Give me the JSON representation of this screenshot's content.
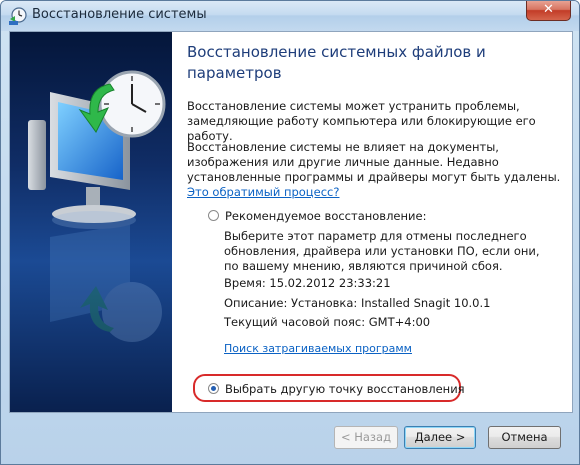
{
  "window": {
    "title": "Восстановление системы",
    "close_label": "✕"
  },
  "main": {
    "heading": "Восстановление системных файлов и параметров",
    "paragraph1": "Восстановление системы может устранить проблемы, замедляющие работу компьютера или блокирующие его работу.",
    "paragraph2_text": "Восстановление системы не влияет на документы, изображения или другие личные данные. Недавно установленные программы и драйверы могут быть удалены.",
    "paragraph2_link": "Это обратимый процесс?",
    "recommended": {
      "label": "Рекомендуемое восстановление:",
      "description": "Выберите этот параметр для отмены последнего обновления, драйвера или установки ПО, если они, по вашему мнению, являются причиной сбоя.",
      "time": "Время: 15.02.2012 23:33:21",
      "description_line": "Описание: Установка: Installed Snagit 10.0.1",
      "timezone": "Текущий часовой пояс: GMT+4:00",
      "affected_link": "Поиск затрагиваемых программ",
      "selected": false
    },
    "other_point": {
      "label": "Выбрать другую точку восстановления",
      "selected": true
    }
  },
  "buttons": {
    "back": "< Назад",
    "next": "Далее >",
    "cancel": "Отмена"
  },
  "icons": {
    "app": "system-restore-icon",
    "illustration": "monitor-with-clock-icon"
  },
  "colors": {
    "heading": "#1e3d7a",
    "link": "#0b62c4",
    "highlight": "#d82a2a"
  }
}
